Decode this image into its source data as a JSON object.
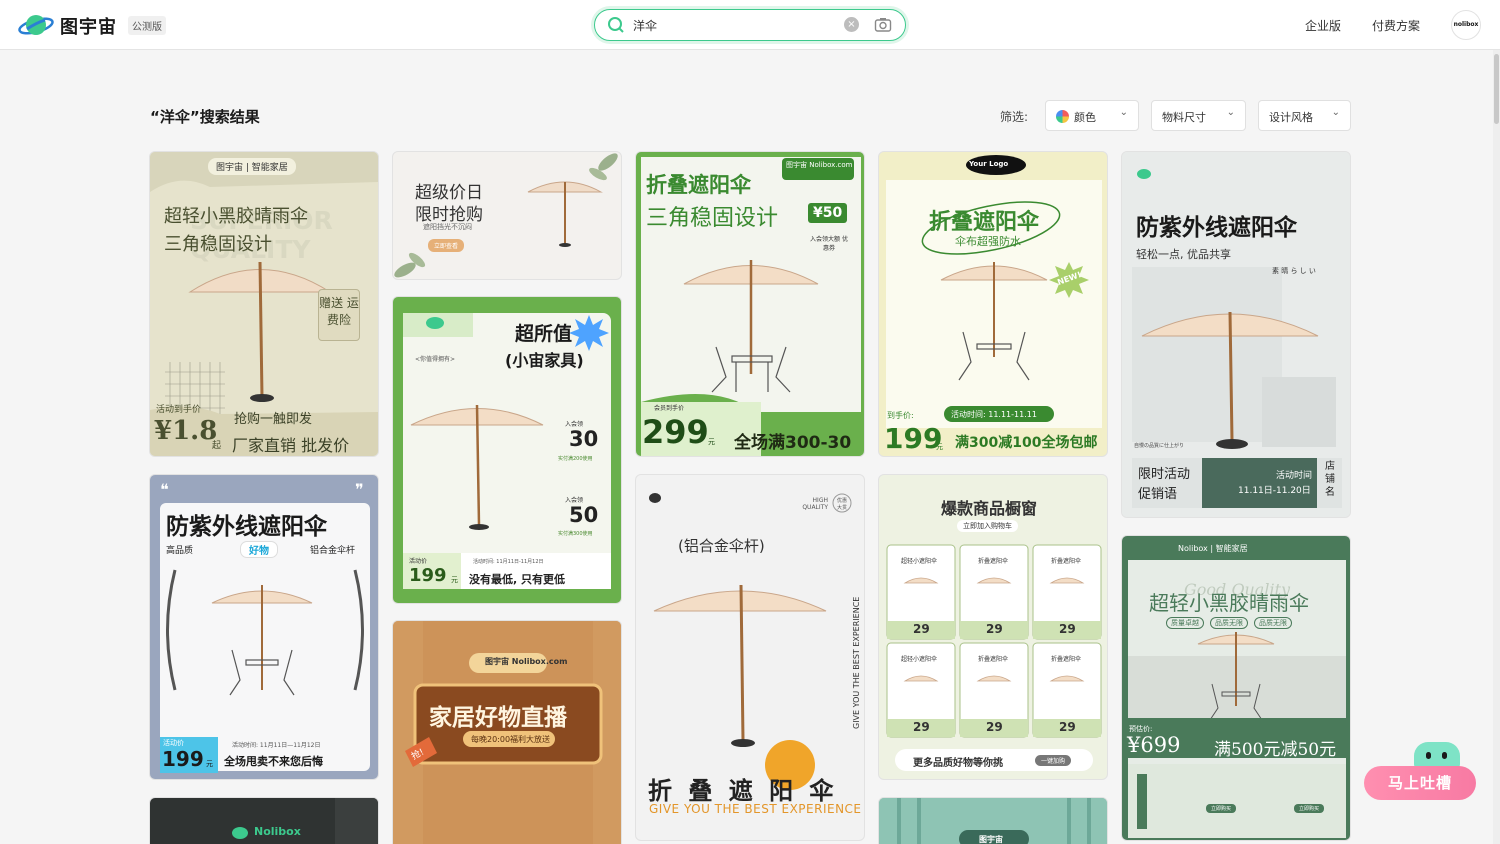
{
  "header": {
    "brand": "图宇宙",
    "beta": "公测版",
    "search_value": "洋伞",
    "links": [
      "企业版",
      "付费方案"
    ],
    "avatar_text": "nolibox"
  },
  "results": {
    "title": "“洋伞”搜索结果",
    "filter_label": "筛选:",
    "filters": [
      "颜色",
      "物料尺寸",
      "设计风格"
    ]
  },
  "cards": {
    "c1": {
      "badge": "图宇宙 | 智能家居",
      "title1": "超轻小黑胶晴雨伞",
      "title2": "三角稳固设计",
      "watermark": "SUPERIOR QUALITY",
      "gift": "赠送 运费险",
      "sub": "活动到手价",
      "price": "¥1.8",
      "unit": "起",
      "promo1": "抢购一触即发",
      "promo2": "厂家直销 批发价"
    },
    "c2": {
      "t1": "超级价日",
      "t2": "限时抢购",
      "t3": "遮阳挡光不沉闷",
      "btn": "立即查看"
    },
    "c3": {
      "t1": "超所值",
      "t2": "(小宙家具)",
      "t3": "<你值得拥有>",
      "p1": "30",
      "p1s": "实付满200使用",
      "p2": "50",
      "p2s": "实付满300使用",
      "coupon": "入会领",
      "act": "活动价",
      "price": "199",
      "unit": "元",
      "time": "活动时间: 11月11日-11月12日",
      "slogan": "没有最低, 只有更低"
    },
    "c4": {
      "t1": "折叠遮阳伞",
      "t2": "三角稳固设计",
      "badge": "图宇宙 Nolibox.com",
      "coupon": "¥50",
      "cpn_sub": "入会领大额 优惠券",
      "act": "会员到手价",
      "price": "299",
      "unit": "元",
      "slogan": "全场满300-30"
    },
    "c5": {
      "logo": "Your Logo",
      "t1": "折叠遮阳伞",
      "t2": "伞布超强防水",
      "new": "NEW!",
      "act": "到手价:",
      "time": "活动时间: 11.11-11.11",
      "price": "199",
      "unit": "元",
      "slogan": "满300减100全场包邮"
    },
    "c6": {
      "t1": "防紫外线遮阳伞",
      "t2": "轻松一点, 优品共享",
      "t3": "素 晴 ら し い",
      "t4": "自慢の品質に仕上がり",
      "l1": "限时活动",
      "l2": "促销语",
      "tl": "活动时间",
      "tv": "11.11日-11.20日",
      "shop": "店铺名"
    },
    "c7": {
      "t1": "防紫外线遮阳伞",
      "q1": "高品质",
      "pill": "好物",
      "q2": "铝合金伞杆",
      "act": "活动价",
      "time": "活动时间: 11月11日—11月12日",
      "price": "199",
      "unit": "元",
      "slogan": "全场甩卖不来您后悔"
    },
    "c8": {
      "badge": "图宇宙 Nolibox.com",
      "t1": "家居好物直播",
      "t2": "每晚20:00福利大放送",
      "tag": "抢!"
    },
    "c9": {
      "hq": "HIGH QUALITY",
      "seal": "优惠 大贯",
      "t1": "(铝合金伞杆)",
      "side": "GIVE YOU THE BEST EXPERIENCE",
      "t2": "折 叠 遮 阳 伞",
      "t3": "GIVE YOU THE BEST EXPERIENCE"
    },
    "c10": {
      "t1": "爆款商品橱窗",
      "btn": "立即加入购物车",
      "items": [
        "超轻小遮阳伞",
        "折叠遮阳伞",
        "折叠遮阳伞",
        "超轻小遮阳伞",
        "折叠遮阳伞",
        "折叠遮阳伞"
      ],
      "price": "29",
      "more": "更多品质好物等你挑",
      "cart": "一键加购"
    },
    "c11": {
      "badge": "Nolibox | 智能家居",
      "t1": "超轻小黑胶晴雨伞",
      "tags": [
        "质量卓越",
        "品质无限",
        "品质无限"
      ],
      "script": "Good Quality",
      "est": "预估价:",
      "price": "¥699",
      "slogan": "满500元减50元",
      "btn": "立即购买"
    },
    "c12": {
      "badge": "Nolibox"
    },
    "c14": {
      "badge": "图宇宙"
    }
  },
  "fab": {
    "label": "马上吐槽"
  },
  "colors": {
    "accent": "#3cc98d",
    "green": "#6ab04c",
    "orange": "#e39a2f"
  }
}
